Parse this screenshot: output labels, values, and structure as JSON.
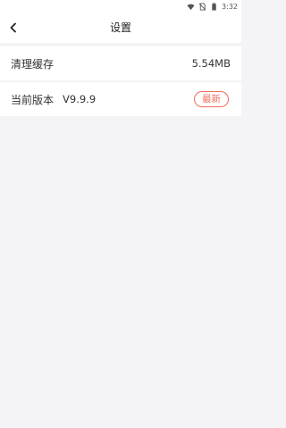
{
  "status_bar": {
    "time": "3:32",
    "icons": [
      "wifi-icon",
      "no-sim-icon",
      "battery-icon"
    ]
  },
  "nav": {
    "title": "设置",
    "back_icon": "chevron-left-icon"
  },
  "settings": {
    "cache": {
      "label": "清理缓存",
      "value": "5.54MB"
    },
    "version": {
      "label": "当前版本",
      "value": "V9.9.9",
      "badge": "最新"
    }
  },
  "colors": {
    "background": "#f4f4f6",
    "surface": "#ffffff",
    "text": "#333333",
    "badge_accent": "#f26d5b"
  }
}
